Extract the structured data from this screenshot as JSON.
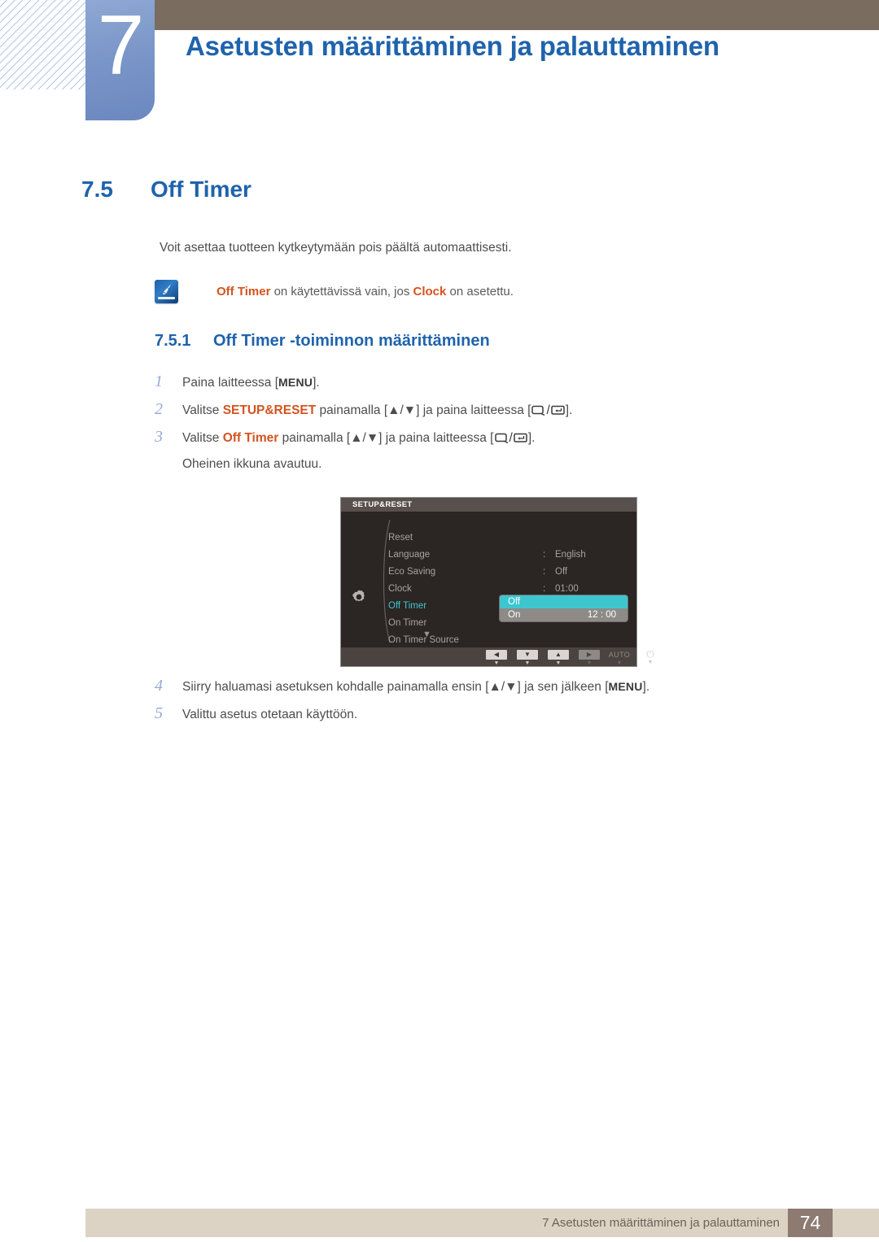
{
  "header": {
    "chapter_number": "7",
    "chapter_title": "Asetusten määrittäminen ja palauttaminen",
    "bar_color": "#7a6d60",
    "badge_color": "#7b96c8",
    "title_color": "#1f63ac"
  },
  "section": {
    "number": "7.5",
    "title": "Off Timer",
    "intro": "Voit asettaa tuotteen kytkeytymään pois päältä automaattisesti."
  },
  "note": {
    "icon": "note-pen-icon",
    "text_part1": "Off Timer",
    "text_part2": " on käytettävissä vain, jos ",
    "text_part3": "Clock",
    "text_part4": " on asetettu.",
    "highlight_color": "#d4541f"
  },
  "subsection": {
    "number": "7.5.1",
    "title": "Off Timer -toiminnon määrittäminen"
  },
  "steps": [
    {
      "num": "1",
      "prefix": "Paina laitteessa [",
      "key": "MENU",
      "suffix": "]."
    },
    {
      "num": "2",
      "prefix": "Valitse ",
      "highlight": "SETUP&RESET",
      "middle": " painamalla [▲/▼] ja paina laitteessa [",
      "icons": "source/enter",
      "suffix": "]."
    },
    {
      "num": "3",
      "prefix": "Valitse ",
      "highlight": "Off Timer",
      "middle": " painamalla [▲/▼] ja paina laitteessa [",
      "icons": "source/enter",
      "suffix": "].",
      "subline": "Oheinen ikkuna avautuu."
    },
    {
      "num": "4",
      "prefix": "Siirry haluamasi asetuksen kohdalle painamalla ensin [▲/▼] ja sen jälkeen [",
      "key": "MENU",
      "suffix": "]."
    },
    {
      "num": "5",
      "prefix": "Valittu asetus otetaan käyttöön."
    }
  ],
  "osd": {
    "title": "SETUP&RESET",
    "gear_icon": "gear-icon",
    "scroll_down_icon": "chevron-down-icon",
    "rows": [
      {
        "label": "Reset",
        "colon": "",
        "value": ""
      },
      {
        "label": "Language",
        "colon": ":",
        "value": "English"
      },
      {
        "label": "Eco Saving",
        "colon": ":",
        "value": "Off"
      },
      {
        "label": "Clock",
        "colon": ":",
        "value": "01:00"
      },
      {
        "label": "Off Timer",
        "colon": ":",
        "value": "",
        "active": true
      },
      {
        "label": "On Timer",
        "colon": "",
        "value": ""
      },
      {
        "label": "On Timer Source",
        "colon": "",
        "value": ""
      }
    ],
    "popup": {
      "option_off": "Off",
      "option_on": "On",
      "option_on_time": "12 : 00",
      "selected": "Off",
      "selected_color": "#3ec6cf"
    },
    "footer_buttons": [
      {
        "name": "left-button",
        "glyph": "◀",
        "sub": "▼"
      },
      {
        "name": "down-button",
        "glyph": "▼",
        "sub": "▼"
      },
      {
        "name": "up-button",
        "glyph": "▲",
        "sub": "▼"
      },
      {
        "name": "right-button",
        "glyph": "▶",
        "sub": "▼"
      },
      {
        "name": "auto-button",
        "glyph": "AUTO",
        "sub": "▼"
      },
      {
        "name": "power-button",
        "glyph": "⏻",
        "sub": "▼"
      }
    ]
  },
  "footer": {
    "text": "7 Asetusten määrittäminen ja palauttaminen",
    "page_number": "74",
    "bar_color": "#dcd3c4",
    "pageno_color": "#8d7a70"
  }
}
